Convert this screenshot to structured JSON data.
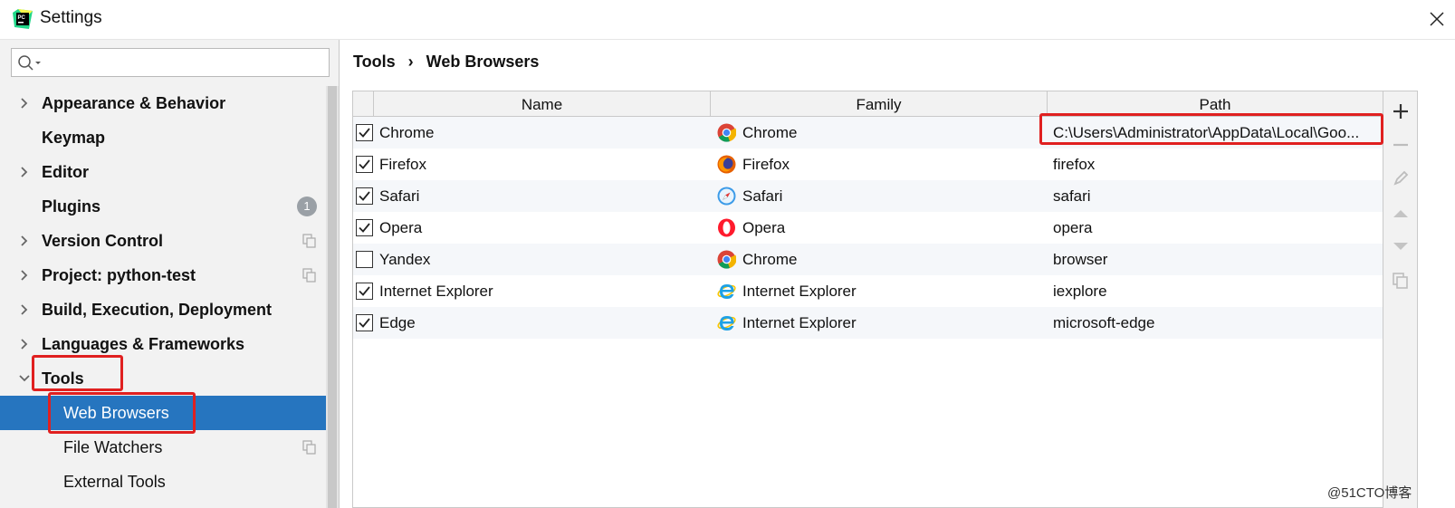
{
  "window": {
    "title": "Settings"
  },
  "sidebar": {
    "items": [
      {
        "label": "Appearance & Behavior",
        "expandable": true
      },
      {
        "label": "Keymap",
        "expandable": false
      },
      {
        "label": "Editor",
        "expandable": true
      },
      {
        "label": "Plugins",
        "expandable": false,
        "badge": "1"
      },
      {
        "label": "Version Control",
        "expandable": true
      },
      {
        "label": "Project: python-test",
        "expandable": true
      },
      {
        "label": "Build, Execution, Deployment",
        "expandable": true
      },
      {
        "label": "Languages & Frameworks",
        "expandable": true
      },
      {
        "label": "Tools",
        "expandable": true,
        "expanded": true
      },
      {
        "label": "Web Browsers",
        "child": true,
        "selected": true
      },
      {
        "label": "File Watchers",
        "child": true
      },
      {
        "label": "External Tools",
        "child": true
      }
    ]
  },
  "breadcrumb": {
    "parent": "Tools",
    "current": "Web Browsers"
  },
  "table": {
    "columns": [
      "Name",
      "Family",
      "Path"
    ],
    "rows": [
      {
        "checked": true,
        "name": "Chrome",
        "family": "Chrome",
        "family_icon": "chrome-icon",
        "path": "C:\\Users\\Administrator\\AppData\\Local\\Goo..."
      },
      {
        "checked": true,
        "name": "Firefox",
        "family": "Firefox",
        "family_icon": "firefox-icon",
        "path": "firefox"
      },
      {
        "checked": true,
        "name": "Safari",
        "family": "Safari",
        "family_icon": "safari-icon",
        "path": "safari"
      },
      {
        "checked": true,
        "name": "Opera",
        "family": "Opera",
        "family_icon": "opera-icon",
        "path": "opera"
      },
      {
        "checked": false,
        "name": "Yandex",
        "family": "Chrome",
        "family_icon": "chrome-icon",
        "path": "browser"
      },
      {
        "checked": true,
        "name": "Internet Explorer",
        "family": "Internet Explorer",
        "family_icon": "ie-icon",
        "path": "iexplore"
      },
      {
        "checked": true,
        "name": "Edge",
        "family": "Internet Explorer",
        "family_icon": "ie-icon",
        "path": "microsoft-edge"
      }
    ]
  },
  "watermark": "@51CTO博客",
  "colors": {
    "selection": "#2675bf",
    "highlight": "#e02020",
    "panel": "#f2f2f2"
  }
}
